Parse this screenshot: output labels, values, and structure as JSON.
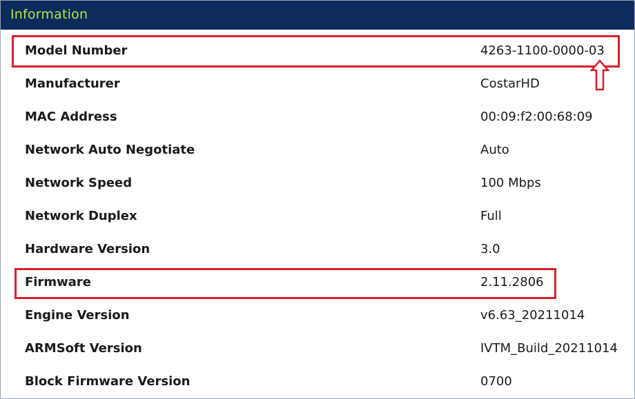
{
  "panel": {
    "title": "Information"
  },
  "rows": [
    {
      "label": "Model Number",
      "value": "4263-1100-0000-03"
    },
    {
      "label": "Manufacturer",
      "value": "CostarHD"
    },
    {
      "label": "MAC Address",
      "value": "00:09:f2:00:68:09"
    },
    {
      "label": "Network Auto Negotiate",
      "value": "Auto"
    },
    {
      "label": "Network Speed",
      "value": "100 Mbps"
    },
    {
      "label": "Network Duplex",
      "value": "Full"
    },
    {
      "label": "Hardware Version",
      "value": "3.0"
    },
    {
      "label": "Firmware",
      "value": "2.11.2806"
    },
    {
      "label": "Engine Version",
      "value": "v6.63_20211014"
    },
    {
      "label": "ARMSoft Version",
      "value": "IVTM_Build_20211014"
    },
    {
      "label": "Block Firmware Version",
      "value": "0700"
    }
  ],
  "annotations": {
    "highlight_color": "#d81f2a",
    "arrow_icon": "up-arrow-outline-icon"
  },
  "colors": {
    "header_bg": "#0d2b5c",
    "header_text": "#b6e640"
  }
}
